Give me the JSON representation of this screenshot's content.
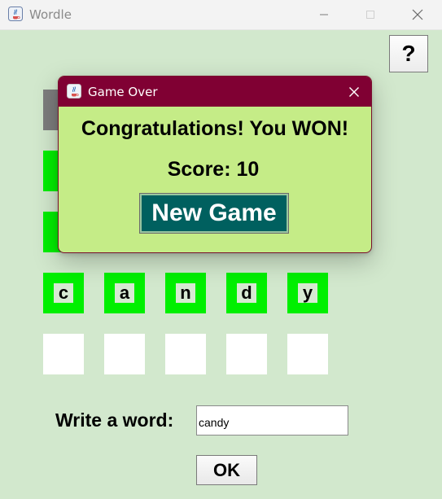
{
  "window": {
    "title": "Wordle"
  },
  "help": {
    "label": "?"
  },
  "grid": {
    "rows": [
      {
        "state": "gray-partial"
      },
      {
        "state": "green-partial"
      },
      {
        "state": "green-partial"
      },
      {
        "letters": [
          "c",
          "a",
          "n",
          "d",
          "y"
        ],
        "state": "green"
      },
      {
        "letters": [
          "",
          "",
          "",
          "",
          ""
        ],
        "state": "empty"
      }
    ]
  },
  "input": {
    "label": "Write a word:",
    "value": "candy"
  },
  "ok": {
    "label": "OK"
  },
  "dialog": {
    "title": "Game Over",
    "message": "Congratulations! You WON!",
    "score": "Score: 10",
    "new_game_label": "New Game"
  },
  "colors": {
    "background": "#d2e8cd",
    "correct": "#00f000",
    "absent": "#7d7d7d",
    "dialog_title": "#800033",
    "dialog_body": "#c5ec87",
    "new_game_button": "#00605f"
  }
}
